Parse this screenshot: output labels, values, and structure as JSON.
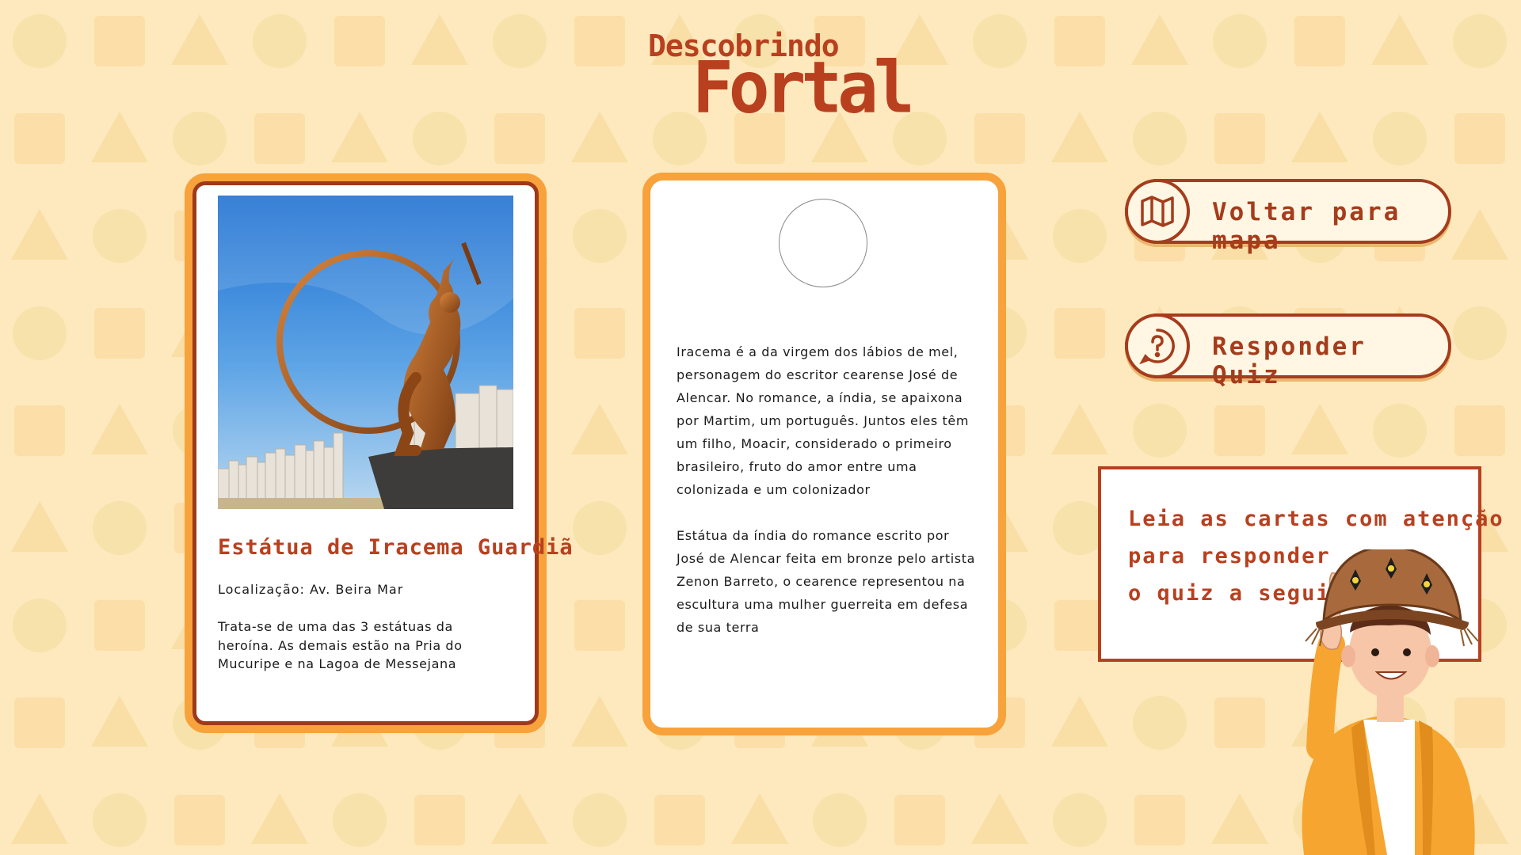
{
  "logo": {
    "line1": "Descobrindo",
    "line2": "Fortal"
  },
  "card": {
    "title": "Estátua de Iracema Guardiã",
    "location": "Localização: Av. Beira Mar",
    "description": "Trata-se de uma das 3 estátuas da heroína. As demais estão na Pria do Mucuripe e na Lagoa de Messejana"
  },
  "info": {
    "paragraph1": "Iracema é a da virgem dos lábios de mel, personagem do escritor cearense José de Alencar. No romance, a índia, se apaixona por Martim, um português. Juntos eles têm um filho, Moacir, considerado o primeiro brasileiro, fruto do amor entre uma colonizada e um colonizador",
    "paragraph2": "Estátua da índia do romance escrito por José de Alencar feita em bronze pelo artista Zenon Barreto, o cearence representou na escultura uma mulher guerreita em defesa de sua terra"
  },
  "buttons": {
    "map_label": "Voltar para mapa",
    "quiz_label": "Responder Quiz"
  },
  "message": {
    "line1": "Leia as cartas com atenção",
    "line2": "para responder",
    "line3": "o quiz a seguir."
  },
  "icons": {
    "map": "map-icon",
    "quiz": "question-bubble-icon"
  },
  "colors": {
    "background": "#fde9bd",
    "brand": "#b8401f",
    "card_border": "#f7a23b"
  }
}
